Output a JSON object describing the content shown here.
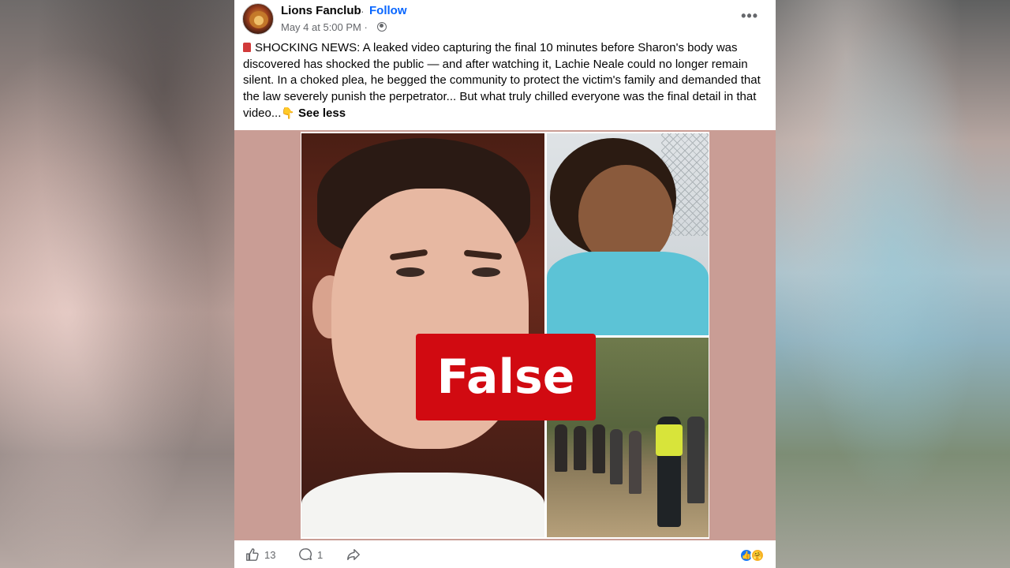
{
  "post": {
    "page_name": "Lions Fanclub",
    "separator": "·",
    "follow_label": "Follow",
    "timestamp": "May 4 at 5:00 PM ·",
    "more_label": "•••",
    "text": "SHOCKING NEWS: A leaked video capturing the final 10 minutes before Sharon's body was discovered has shocked the public — and after watching it, Lachie Neale could no longer remain silent. In a choked plea, he begged the community to protect the victim's family and demanded that the law severely punish the perpetrator... But what truly chilled everyone was the final detail in that video...",
    "pointing_emoji": "👇",
    "see_less": "See less"
  },
  "overlay": {
    "label": "False",
    "color": "#d10a11"
  },
  "actions": {
    "like_count": "13",
    "comment_count": "1",
    "icons": [
      "like-icon",
      "comment-icon",
      "share-icon"
    ]
  },
  "reactions": {
    "like_glyph": "👍",
    "care_glyph": "🤗"
  },
  "colors": {
    "link": "#0866ff",
    "media_background": "#c99d95"
  }
}
